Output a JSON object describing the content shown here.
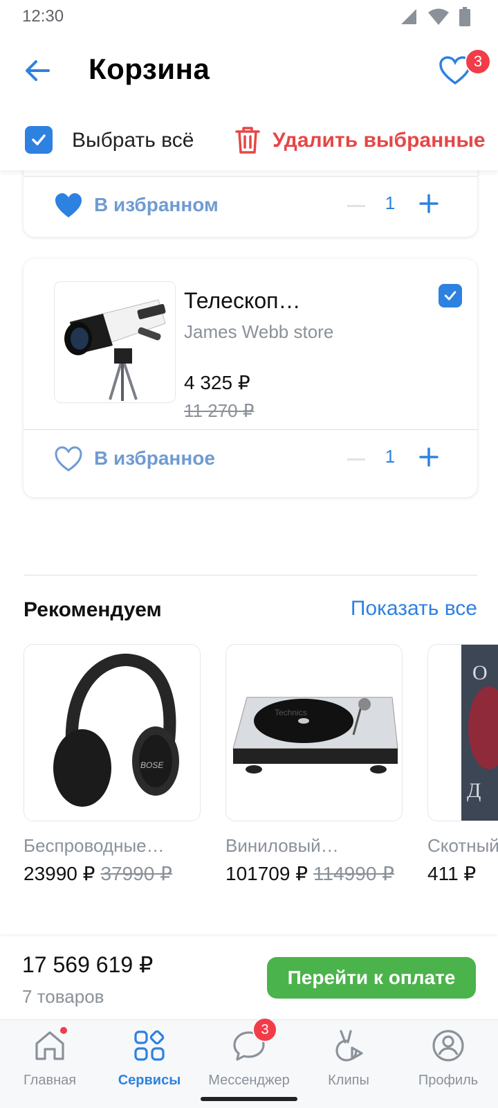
{
  "status": {
    "time": "12:30"
  },
  "header": {
    "title": "Корзина",
    "fav_badge": "3"
  },
  "selection": {
    "select_all": "Выбрать всё",
    "delete_selected": "Удалить выбранные"
  },
  "cart": [
    {
      "fav_label": "В избранном",
      "qty": "1",
      "favorited": true
    },
    {
      "name": "Телескоп…",
      "store": "James Webb store",
      "price": "4 325 ₽",
      "old_price": "11 270 ₽",
      "fav_label": "В избранное",
      "qty": "1",
      "favorited": false
    }
  ],
  "recommend": {
    "title": "Рекомендуем",
    "show_all": "Показать все",
    "items": [
      {
        "name": "Беспроводные…",
        "price": "23990 ₽",
        "old_price": "37990 ₽"
      },
      {
        "name": "Виниловый…",
        "price": "101709 ₽",
        "old_price": "114990 ₽"
      },
      {
        "name": "Скотный…",
        "price": "411 ₽",
        "old_price": ""
      }
    ]
  },
  "checkout": {
    "total": "17 569 619 ₽",
    "count": "7 товаров",
    "pay": "Перейти к оплате"
  },
  "nav": [
    {
      "label": "Главная",
      "icon": "home-icon"
    },
    {
      "label": "Сервисы",
      "icon": "services-icon",
      "active": true
    },
    {
      "label": "Мессенджер",
      "icon": "messenger-icon",
      "badge": "3"
    },
    {
      "label": "Клипы",
      "icon": "clips-icon"
    },
    {
      "label": "Профиль",
      "icon": "profile-icon"
    }
  ],
  "colors": {
    "accent": "#2d81e0",
    "danger": "#e64646",
    "pay": "#4bb34b",
    "badge": "#f23c48"
  }
}
